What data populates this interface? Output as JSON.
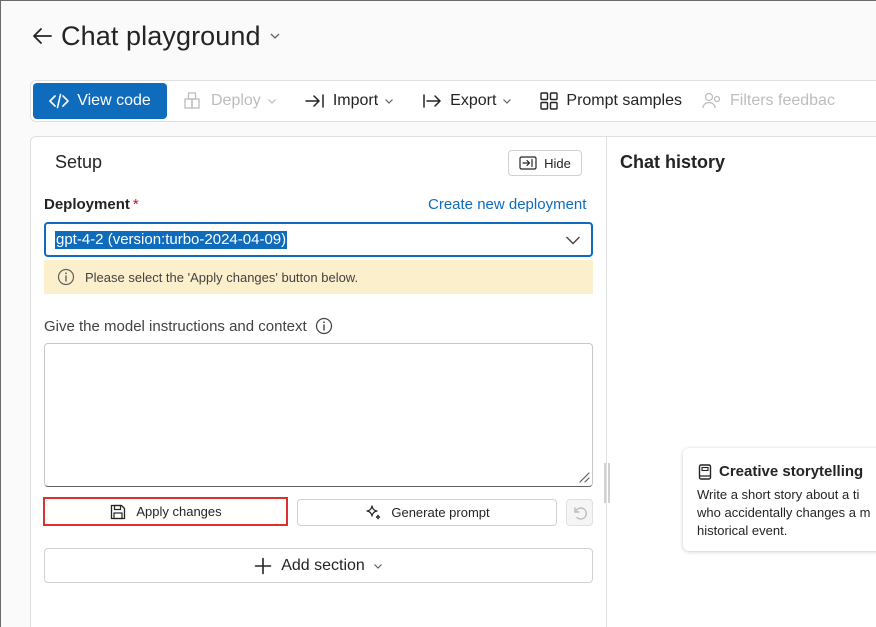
{
  "header": {
    "title": "Chat playground"
  },
  "toolbar": {
    "view_code": "View code",
    "deploy": "Deploy",
    "import": "Import",
    "export": "Export",
    "prompt_samples": "Prompt samples",
    "filters_feedback": "Filters feedbac"
  },
  "setup": {
    "title": "Setup",
    "hide_label": "Hide",
    "deployment_label": "Deployment",
    "required_marker": "*",
    "create_link": "Create new deployment",
    "deployment_value": "gpt-4-2 (version:turbo-2024-04-09)",
    "warning": "Please select the 'Apply changes' button below.",
    "instructions_label": "Give the model instructions and context",
    "instructions_value": "",
    "apply_changes": "Apply changes",
    "generate_prompt": "Generate prompt",
    "add_section": "Add section"
  },
  "chat": {
    "title": "Chat history",
    "card": {
      "title": "Creative storytelling",
      "body": "Write a short story about a ti\nwho accidentally changes a m\nhistorical event."
    }
  },
  "colors": {
    "primary": "#0f6cbd",
    "warning_bg": "#fcefcc",
    "highlight_border": "#e02f2f",
    "required": "#c50f1f"
  }
}
